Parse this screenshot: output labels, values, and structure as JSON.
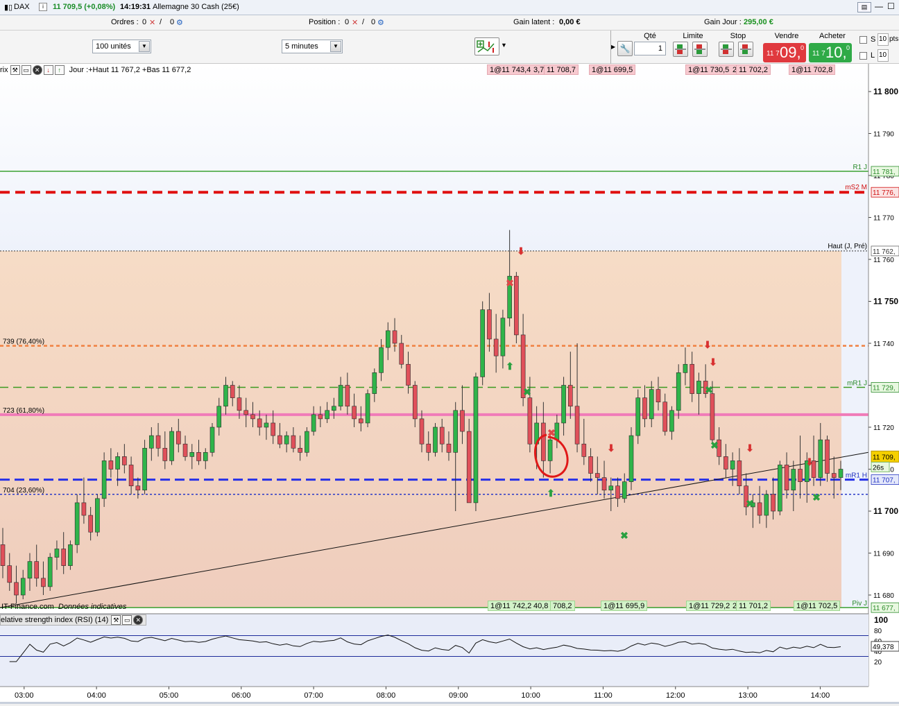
{
  "titlebar": {
    "instrument": "DAX",
    "price_change": "11 709,5 (+0,08%)",
    "time": "14:19:31",
    "market_name": "Allemagne 30 Cash (25€)"
  },
  "toolbar": {
    "orders_label": "Ordres :",
    "orders_value": "0",
    "orders_value2": "0",
    "position_label": "Position :",
    "position_value": "0",
    "position_value2": "0",
    "gain_latent_label": "Gain latent :",
    "gain_latent_value": "0,00 €",
    "gain_jour_label": "Gain Jour :",
    "gain_jour_value": "295,00 €",
    "units_select": "100 unités",
    "timeframe_select": "5 minutes"
  },
  "order_panel": {
    "qty_label": "Qté",
    "qty_value": "1",
    "limit_label": "Limite",
    "stop_label": "Stop",
    "sell_label": "Vendre",
    "buy_label": "Acheter",
    "sell_prefix": "11 7",
    "sell_main": "09,",
    "sell_sup": "0",
    "buy_prefix": "11 7",
    "buy_main": "10,",
    "buy_sup": "0",
    "s_label": "S",
    "l_label": "L",
    "s_value": "10",
    "l_value": "10",
    "pts_label": "pts"
  },
  "chart_header": {
    "prefix": "rix",
    "day_info": "Jour :+Haut 11 767,2 +Bas 11 677,2"
  },
  "order_tags_top": [
    "1@11 743,4",
    "3,7",
    "11 708,7",
    "1@11 699,5",
    "1@11 730,5",
    "2",
    "11 702,2",
    "1@11 702,8"
  ],
  "order_tags_bottom": [
    "1@11 742,2",
    "40,8",
    "708,2",
    "1@11 695,9",
    "1@11 729,2",
    "2",
    "11 701,2",
    "1@11 702,5"
  ],
  "levels": {
    "r1": "R1 J",
    "r1_value": "11 781,",
    "ms2": "mS2 M",
    "ms2_value": "11 776,",
    "haut": "Haut (J, Pré)",
    "haut_value": "11 762,",
    "mr1j": "mR1 J",
    "mr1j_value": "11 729,",
    "mr1h": "mR1 H",
    "mr1h_value": "11 707,",
    "piv": "Piv J",
    "piv_value": "11 677,",
    "current_price": "11 709,",
    "countdown": "26s",
    "fib1": "739 (76,40%)",
    "fib2": "723 (61,80%)",
    "fib3": "704 (23,60%)"
  },
  "y_axis": [
    "11 800",
    "11 790",
    "11 780",
    "11 770",
    "11 760",
    "11 750",
    "11 740",
    "11 730",
    "11 720",
    "11 710",
    "11 700",
    "11 690",
    "11 680"
  ],
  "x_axis": [
    "03:00",
    "04:00",
    "05:00",
    "06:00",
    "07:00",
    "08:00",
    "09:00",
    "10:00",
    "11:00",
    "12:00",
    "13:00",
    "14:00"
  ],
  "source": "IT-Finance.com",
  "source_note": "Données indicatives",
  "rsi": {
    "title": "elative strength index (RSI) (14)",
    "value": "49,378",
    "axis": [
      "100",
      "80",
      "60",
      "40",
      "20"
    ]
  },
  "colors": {
    "bull": "#2fb44a",
    "bear": "#e0505a",
    "band": "#f3d5c0",
    "pink_line": "#f07bb8",
    "orange_line": "#f08040",
    "blue_line": "#2630e8",
    "red_dash": "#e01010",
    "green_line": "#3aa030"
  },
  "chart_data": {
    "type": "candlestick",
    "instrument": "DAX",
    "timeframe": "5 minutes",
    "ylim": [
      11676,
      11804
    ],
    "x_range": [
      "02:40",
      "14:40"
    ],
    "horizontal_levels": [
      {
        "name": "R1 J",
        "value": 11781
      },
      {
        "name": "mS2 M",
        "value": 11776
      },
      {
        "name": "Haut (J, Pré)",
        "value": 11762
      },
      {
        "name": "739 (76,40%)",
        "value": 11739.4
      },
      {
        "name": "mR1 J",
        "value": 11729.5
      },
      {
        "name": "723 (61,80%)",
        "value": 11723
      },
      {
        "name": "mR1 H",
        "value": 11707.5
      },
      {
        "name": "704 (23,60%)",
        "value": 11704
      },
      {
        "name": "Piv J",
        "value": 11677
      }
    ],
    "candles": [
      [
        11692,
        11696,
        11684,
        11687
      ],
      [
        11687,
        11690,
        11681,
        11683
      ],
      [
        11683,
        11687,
        11678,
        11680
      ],
      [
        11680,
        11686,
        11679,
        11684
      ],
      [
        11684,
        11690,
        11681,
        11688
      ],
      [
        11688,
        11692,
        11682,
        11684
      ],
      [
        11684,
        11688,
        11680,
        11682
      ],
      [
        11682,
        11690,
        11681,
        11689
      ],
      [
        11689,
        11693,
        11686,
        11691
      ],
      [
        11691,
        11695,
        11685,
        11687
      ],
      [
        11687,
        11693,
        11686,
        11692
      ],
      [
        11692,
        11704,
        11690,
        11702
      ],
      [
        11702,
        11708,
        11697,
        11699
      ],
      [
        11699,
        11701,
        11693,
        11695
      ],
      [
        11695,
        11704,
        11694,
        11703
      ],
      [
        11703,
        11714,
        11701,
        11712
      ],
      [
        11712,
        11715,
        11708,
        11710
      ],
      [
        11710,
        11714,
        11706,
        11713
      ],
      [
        11713,
        11716,
        11709,
        11711
      ],
      [
        11711,
        11713,
        11704,
        11706
      ],
      [
        11706,
        11708,
        11703,
        11705
      ],
      [
        11705,
        11717,
        11704,
        11715
      ],
      [
        11715,
        11720,
        11712,
        11718
      ],
      [
        11718,
        11721,
        11713,
        11715
      ],
      [
        11715,
        11719,
        11710,
        11712
      ],
      [
        11712,
        11720,
        11711,
        11719
      ],
      [
        11719,
        11722,
        11714,
        11716
      ],
      [
        11716,
        11718,
        11712,
        11713
      ],
      [
        11713,
        11716,
        11710,
        11714
      ],
      [
        11714,
        11717,
        11711,
        11712
      ],
      [
        11712,
        11715,
        11710,
        11714
      ],
      [
        11714,
        11721,
        11713,
        11720
      ],
      [
        11720,
        11727,
        11718,
        11725
      ],
      [
        11725,
        11732,
        11723,
        11730
      ],
      [
        11730,
        11731,
        11725,
        11727
      ],
      [
        11727,
        11730,
        11722,
        11724
      ],
      [
        11724,
        11727,
        11720,
        11723
      ],
      [
        11723,
        11726,
        11720,
        11722
      ],
      [
        11722,
        11724,
        11718,
        11720
      ],
      [
        11720,
        11723,
        11717,
        11721
      ],
      [
        11721,
        11724,
        11716,
        11718
      ],
      [
        11718,
        11721,
        11715,
        11716
      ],
      [
        11716,
        11719,
        11714,
        11718
      ],
      [
        11718,
        11720,
        11714,
        11715
      ],
      [
        11715,
        11718,
        11712,
        11714
      ],
      [
        11714,
        11720,
        11713,
        11719
      ],
      [
        11719,
        11725,
        11718,
        11723
      ],
      [
        11723,
        11725,
        11720,
        11722
      ],
      [
        11722,
        11726,
        11721,
        11724
      ],
      [
        11724,
        11727,
        11722,
        11725
      ],
      [
        11725,
        11732,
        11724,
        11730
      ],
      [
        11730,
        11733,
        11723,
        11725
      ],
      [
        11725,
        11728,
        11720,
        11722
      ],
      [
        11722,
        11725,
        11719,
        11721
      ],
      [
        11721,
        11729,
        11720,
        11728
      ],
      [
        11728,
        11734,
        11726,
        11733
      ],
      [
        11733,
        11741,
        11731,
        11739
      ],
      [
        11739,
        11745,
        11736,
        11743
      ],
      [
        11743,
        11746,
        11738,
        11740
      ],
      [
        11740,
        11742,
        11734,
        11735
      ],
      [
        11735,
        11738,
        11728,
        11730
      ],
      [
        11730,
        11731,
        11720,
        11722
      ],
      [
        11722,
        11724,
        11714,
        11716
      ],
      [
        11716,
        11719,
        11712,
        11714
      ],
      [
        11714,
        11721,
        11713,
        11720
      ],
      [
        11720,
        11722,
        11714,
        11716
      ],
      [
        11716,
        11719,
        11712,
        11714
      ],
      [
        11714,
        11726,
        11700,
        11724
      ],
      [
        11724,
        11730,
        11716,
        11719
      ],
      [
        11719,
        11722,
        11702,
        11702
      ],
      [
        11702,
        11733,
        11700,
        11732
      ],
      [
        11732,
        11750,
        11730,
        11748
      ],
      [
        11748,
        11752,
        11738,
        11741
      ],
      [
        11741,
        11747,
        11733,
        11737
      ],
      [
        11737,
        11748,
        11734,
        11746
      ],
      [
        11746,
        11767,
        11744,
        11756
      ],
      [
        11756,
        11757,
        11740,
        11742
      ],
      [
        11742,
        11747,
        11725,
        11727
      ],
      [
        11727,
        11732,
        11714,
        11716
      ],
      [
        11716,
        11725,
        11710,
        11721
      ],
      [
        11721,
        11726,
        11708,
        11712
      ],
      [
        11712,
        11719,
        11709,
        11717
      ],
      [
        11717,
        11723,
        11715,
        11721
      ],
      [
        11721,
        11732,
        11718,
        11730
      ],
      [
        11730,
        11738,
        11722,
        11725
      ],
      [
        11725,
        11740,
        11714,
        11716
      ],
      [
        11716,
        11722,
        11711,
        11713
      ],
      [
        11713,
        11715,
        11707,
        11709
      ],
      [
        11709,
        11713,
        11704,
        11708
      ],
      [
        11708,
        11712,
        11703,
        11705
      ],
      [
        11705,
        11708,
        11700,
        11706
      ],
      [
        11706,
        11708,
        11701,
        11703
      ],
      [
        11703,
        11709,
        11702,
        11707
      ],
      [
        11707,
        11720,
        11705,
        11718
      ],
      [
        11718,
        11729,
        11716,
        11727
      ],
      [
        11727,
        11730,
        11720,
        11722
      ],
      [
        11722,
        11731,
        11720,
        11729
      ],
      [
        11729,
        11732,
        11724,
        11726
      ],
      [
        11726,
        11728,
        11718,
        11719
      ],
      [
        11719,
        11725,
        11717,
        11724
      ],
      [
        11724,
        11735,
        11722,
        11733
      ],
      [
        11733,
        11739,
        11730,
        11735
      ],
      [
        11735,
        11738,
        11726,
        11728
      ],
      [
        11728,
        11733,
        11723,
        11731
      ],
      [
        11731,
        11735,
        11727,
        11728
      ],
      [
        11728,
        11731,
        11716,
        11717
      ],
      [
        11717,
        11720,
        11711,
        11713
      ],
      [
        11713,
        11716,
        11708,
        11710
      ],
      [
        11710,
        11714,
        11706,
        11712
      ],
      [
        11712,
        11715,
        11704,
        11706
      ],
      [
        11706,
        11709,
        11699,
        11701
      ],
      [
        11701,
        11704,
        11696,
        11702
      ],
      [
        11702,
        11706,
        11697,
        11699
      ],
      [
        11699,
        11705,
        11696,
        11704
      ],
      [
        11704,
        11708,
        11698,
        11700
      ],
      [
        11700,
        11712,
        11699,
        11711
      ],
      [
        11711,
        11714,
        11703,
        11705
      ],
      [
        11705,
        11712,
        11700,
        11710
      ],
      [
        11710,
        11718,
        11703,
        11707
      ],
      [
        11707,
        11714,
        11702,
        11712
      ],
      [
        11712,
        11718,
        11706,
        11708
      ],
      [
        11708,
        11721,
        11706,
        11717
      ],
      [
        11717,
        11718,
        11707,
        11709
      ],
      [
        11709,
        11713,
        11703,
        11708
      ],
      [
        11708,
        11712,
        11705,
        11710
      ]
    ],
    "trendline": [
      {
        "time": "02:40",
        "value": 11677
      },
      {
        "time": "14:40",
        "value": 11714
      }
    ],
    "rsi": {
      "period": 14,
      "last_value": 49.378,
      "levels": [
        70,
        30
      ]
    }
  }
}
